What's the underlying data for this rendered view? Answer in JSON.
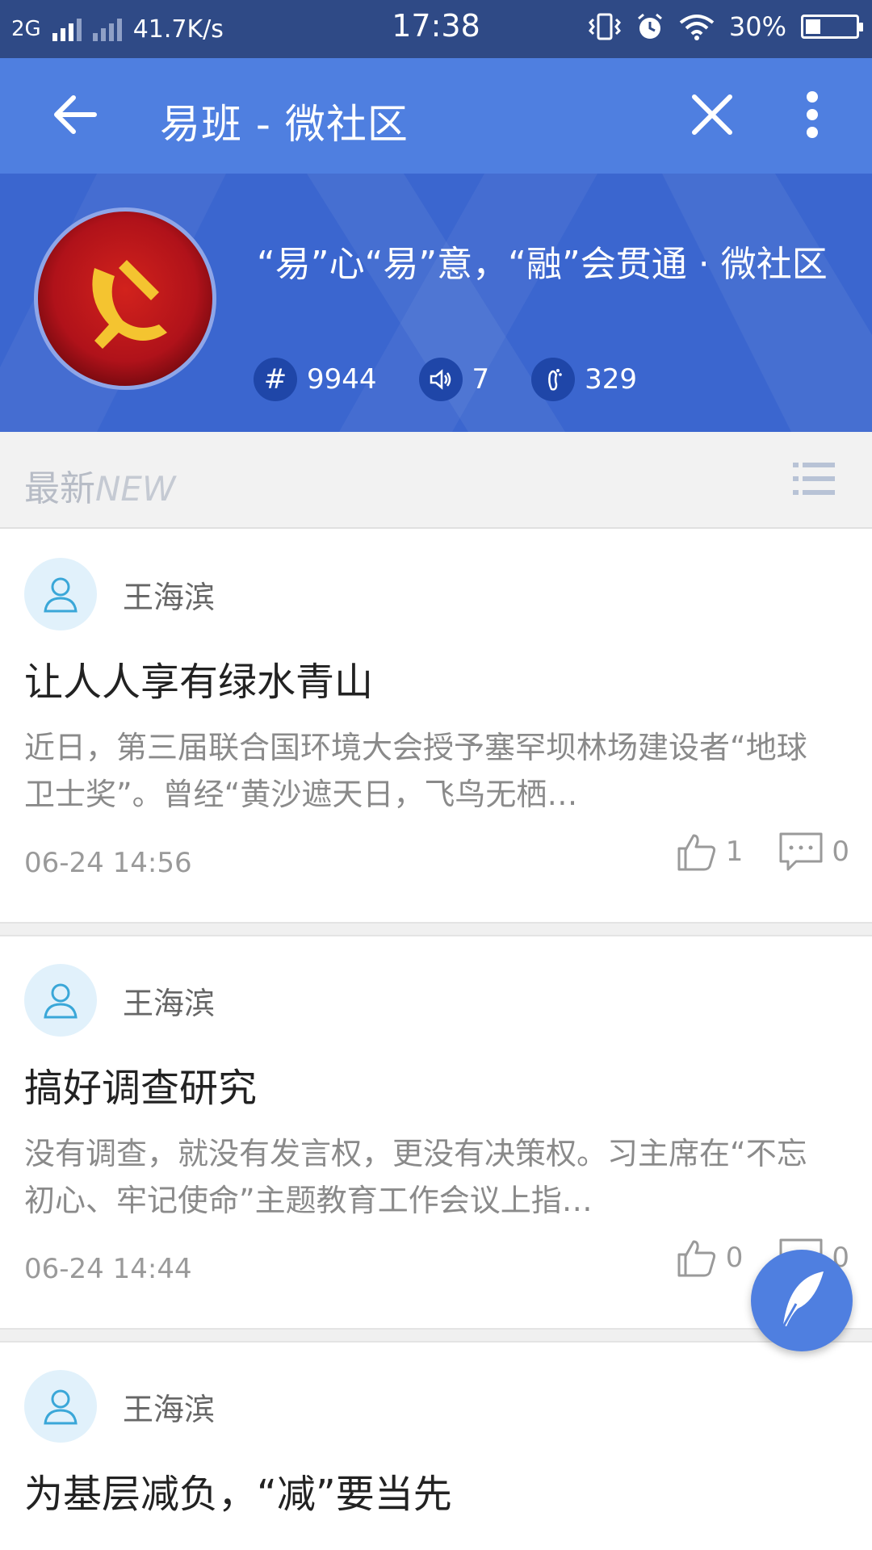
{
  "status_bar": {
    "network": "2G",
    "speed": "41.7K/s",
    "time": "17:38",
    "battery": "30%",
    "battery_level": 0.3
  },
  "app_bar": {
    "title": "易班 - 微社区"
  },
  "community": {
    "slogan": "“易”心“易”意，“融”会贯通 · 微社区",
    "stats": {
      "topics": "9944",
      "announcements": "7",
      "visits": "329"
    }
  },
  "section": {
    "label_cn": "最新",
    "label_en": "NEW"
  },
  "posts": [
    {
      "author": "王海滨",
      "title": "让人人享有绿水青山",
      "summary": "近日，第三届联合国环境大会授予塞罕坝林场建设者“地球卫士奖”。曾经“黄沙遮天日，飞鸟无栖…",
      "time": "06-24 14:56",
      "likes": "1",
      "comments": "0"
    },
    {
      "author": "王海滨",
      "title": "搞好调查研究",
      "summary": "没有调查，就没有发言权，更没有决策权。习主席在“不忘初心、牢记使命”主题教育工作会议上指…",
      "time": "06-24 14:44",
      "likes": "0",
      "comments": "0"
    },
    {
      "author": "王海滨",
      "title": "为基层减负，“减”要当先"
    }
  ],
  "colors": {
    "status_bar": "#2f4a86",
    "app_bar": "#4f7fe0",
    "banner": "#3b66cf",
    "stat_icon_bg": "#1f46a8"
  }
}
